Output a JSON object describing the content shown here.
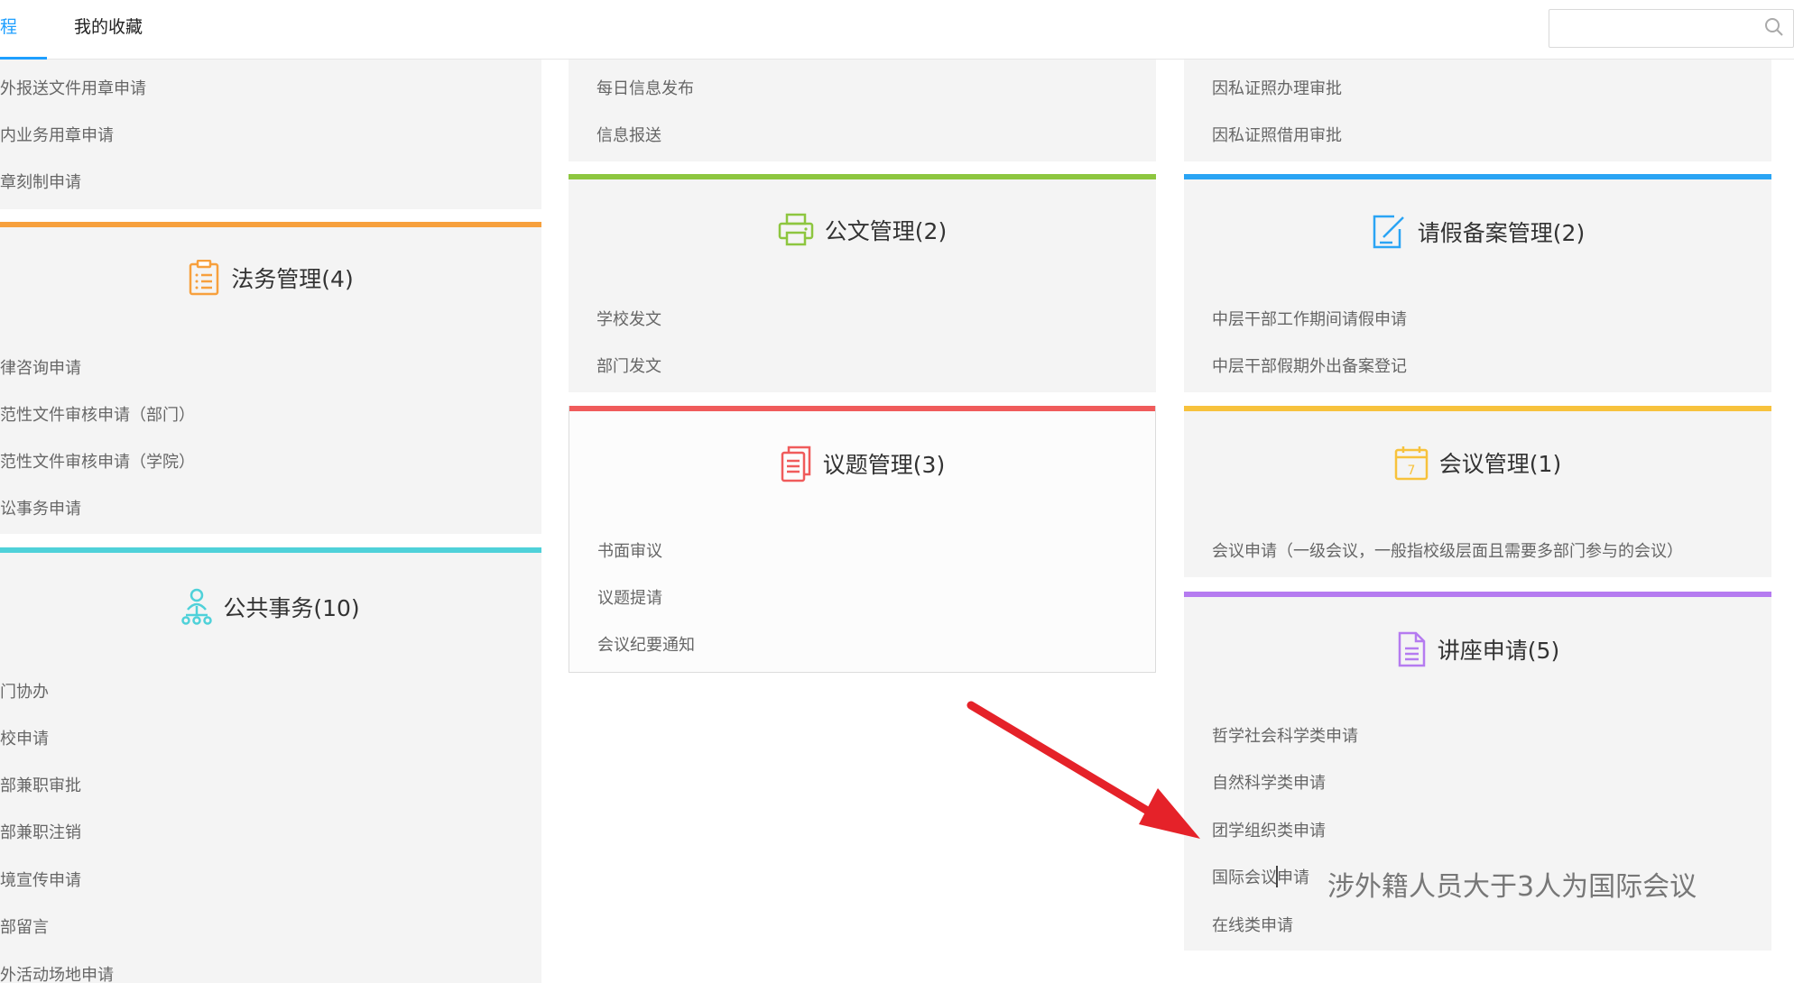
{
  "tabs": [
    {
      "label": "程"
    },
    {
      "label": "我的收藏"
    }
  ],
  "search": {
    "value": "",
    "placeholder": ""
  },
  "col1": {
    "top_items": [
      "外报送文件用章申请",
      "内业务用章申请",
      "章刻制申请"
    ],
    "legal": {
      "title": "法务管理(4)",
      "items": [
        "律咨询申请",
        "范性文件审核申请（部门）",
        "范性文件审核申请（学院）",
        "讼事务申请"
      ]
    },
    "public": {
      "title": "公共事务(10)",
      "items": [
        "门协办",
        "校申请",
        "部兼职审批",
        "部兼职注销",
        "境宣传申请",
        "部留言",
        "外活动场地申请"
      ]
    }
  },
  "col2": {
    "top_items": [
      "每日信息发布",
      "信息报送"
    ],
    "docs": {
      "title": "公文管理(2)",
      "items": [
        "学校发文",
        "部门发文"
      ]
    },
    "topics": {
      "title": "议题管理(3)",
      "items": [
        "书面审议",
        "议题提请",
        "会议纪要通知"
      ]
    }
  },
  "col3": {
    "top_items": [
      "因私证照办理审批",
      "因私证照借用审批"
    ],
    "leave": {
      "title": "请假备案管理(2)",
      "items": [
        "中层干部工作期间请假申请",
        "中层干部假期外出备案登记"
      ]
    },
    "meeting": {
      "title": "会议管理(1)",
      "items": [
        "会议申请（一级会议，一般指校级层面且需要多部门参与的会议）"
      ]
    },
    "lecture": {
      "title": "讲座申请(5)",
      "items": [
        "哲学社会科学类申请",
        "自然科学类申请",
        "团学组织类申请",
        "国际会议申请",
        "在线类申请"
      ]
    }
  },
  "annotation": {
    "text": "涉外籍人员大于3人为国际会议"
  },
  "colors": {
    "accent": "#1e9fff",
    "orange": "#f7a03d",
    "green": "#8dc63f",
    "blue": "#2aa4f4",
    "teal": "#4fd1d9",
    "red": "#f05b5b",
    "yellow": "#f7c23c",
    "purple": "#b57bf0",
    "arrow": "#e52229"
  }
}
